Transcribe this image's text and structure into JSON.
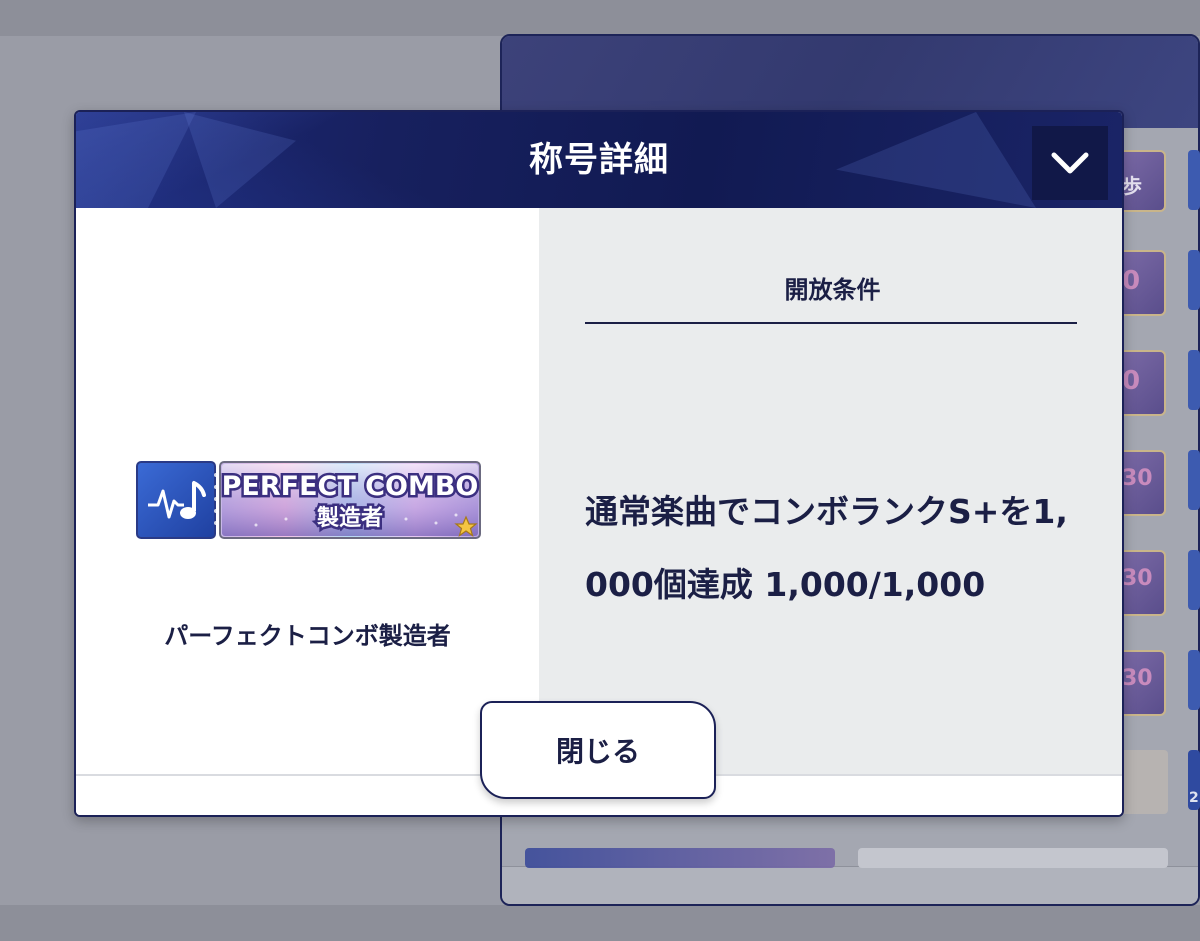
{
  "dialog": {
    "title": "称号詳細",
    "collapse_icon": "chevron-down-icon",
    "close_label": "閉じる"
  },
  "title_detail": {
    "badge_main_text": "PERFECT COMBO",
    "badge_sub_text": "製造者",
    "badge_icon": "music-note-pulse-icon",
    "name": "パーフェクトコンボ製造者"
  },
  "condition": {
    "heading": "開放条件",
    "text": "通常楽曲でコンボランクS+を1,000個達成 1,000/1,000"
  },
  "background": {
    "badge_texts": [
      "歩",
      "0",
      "0",
      "30",
      "30",
      "30"
    ],
    "corner_number": "2"
  },
  "colors": {
    "navy": "#1b2157",
    "header_blue": "#17205e",
    "right_pane": "#eaeced",
    "text": "#1b1f45"
  }
}
